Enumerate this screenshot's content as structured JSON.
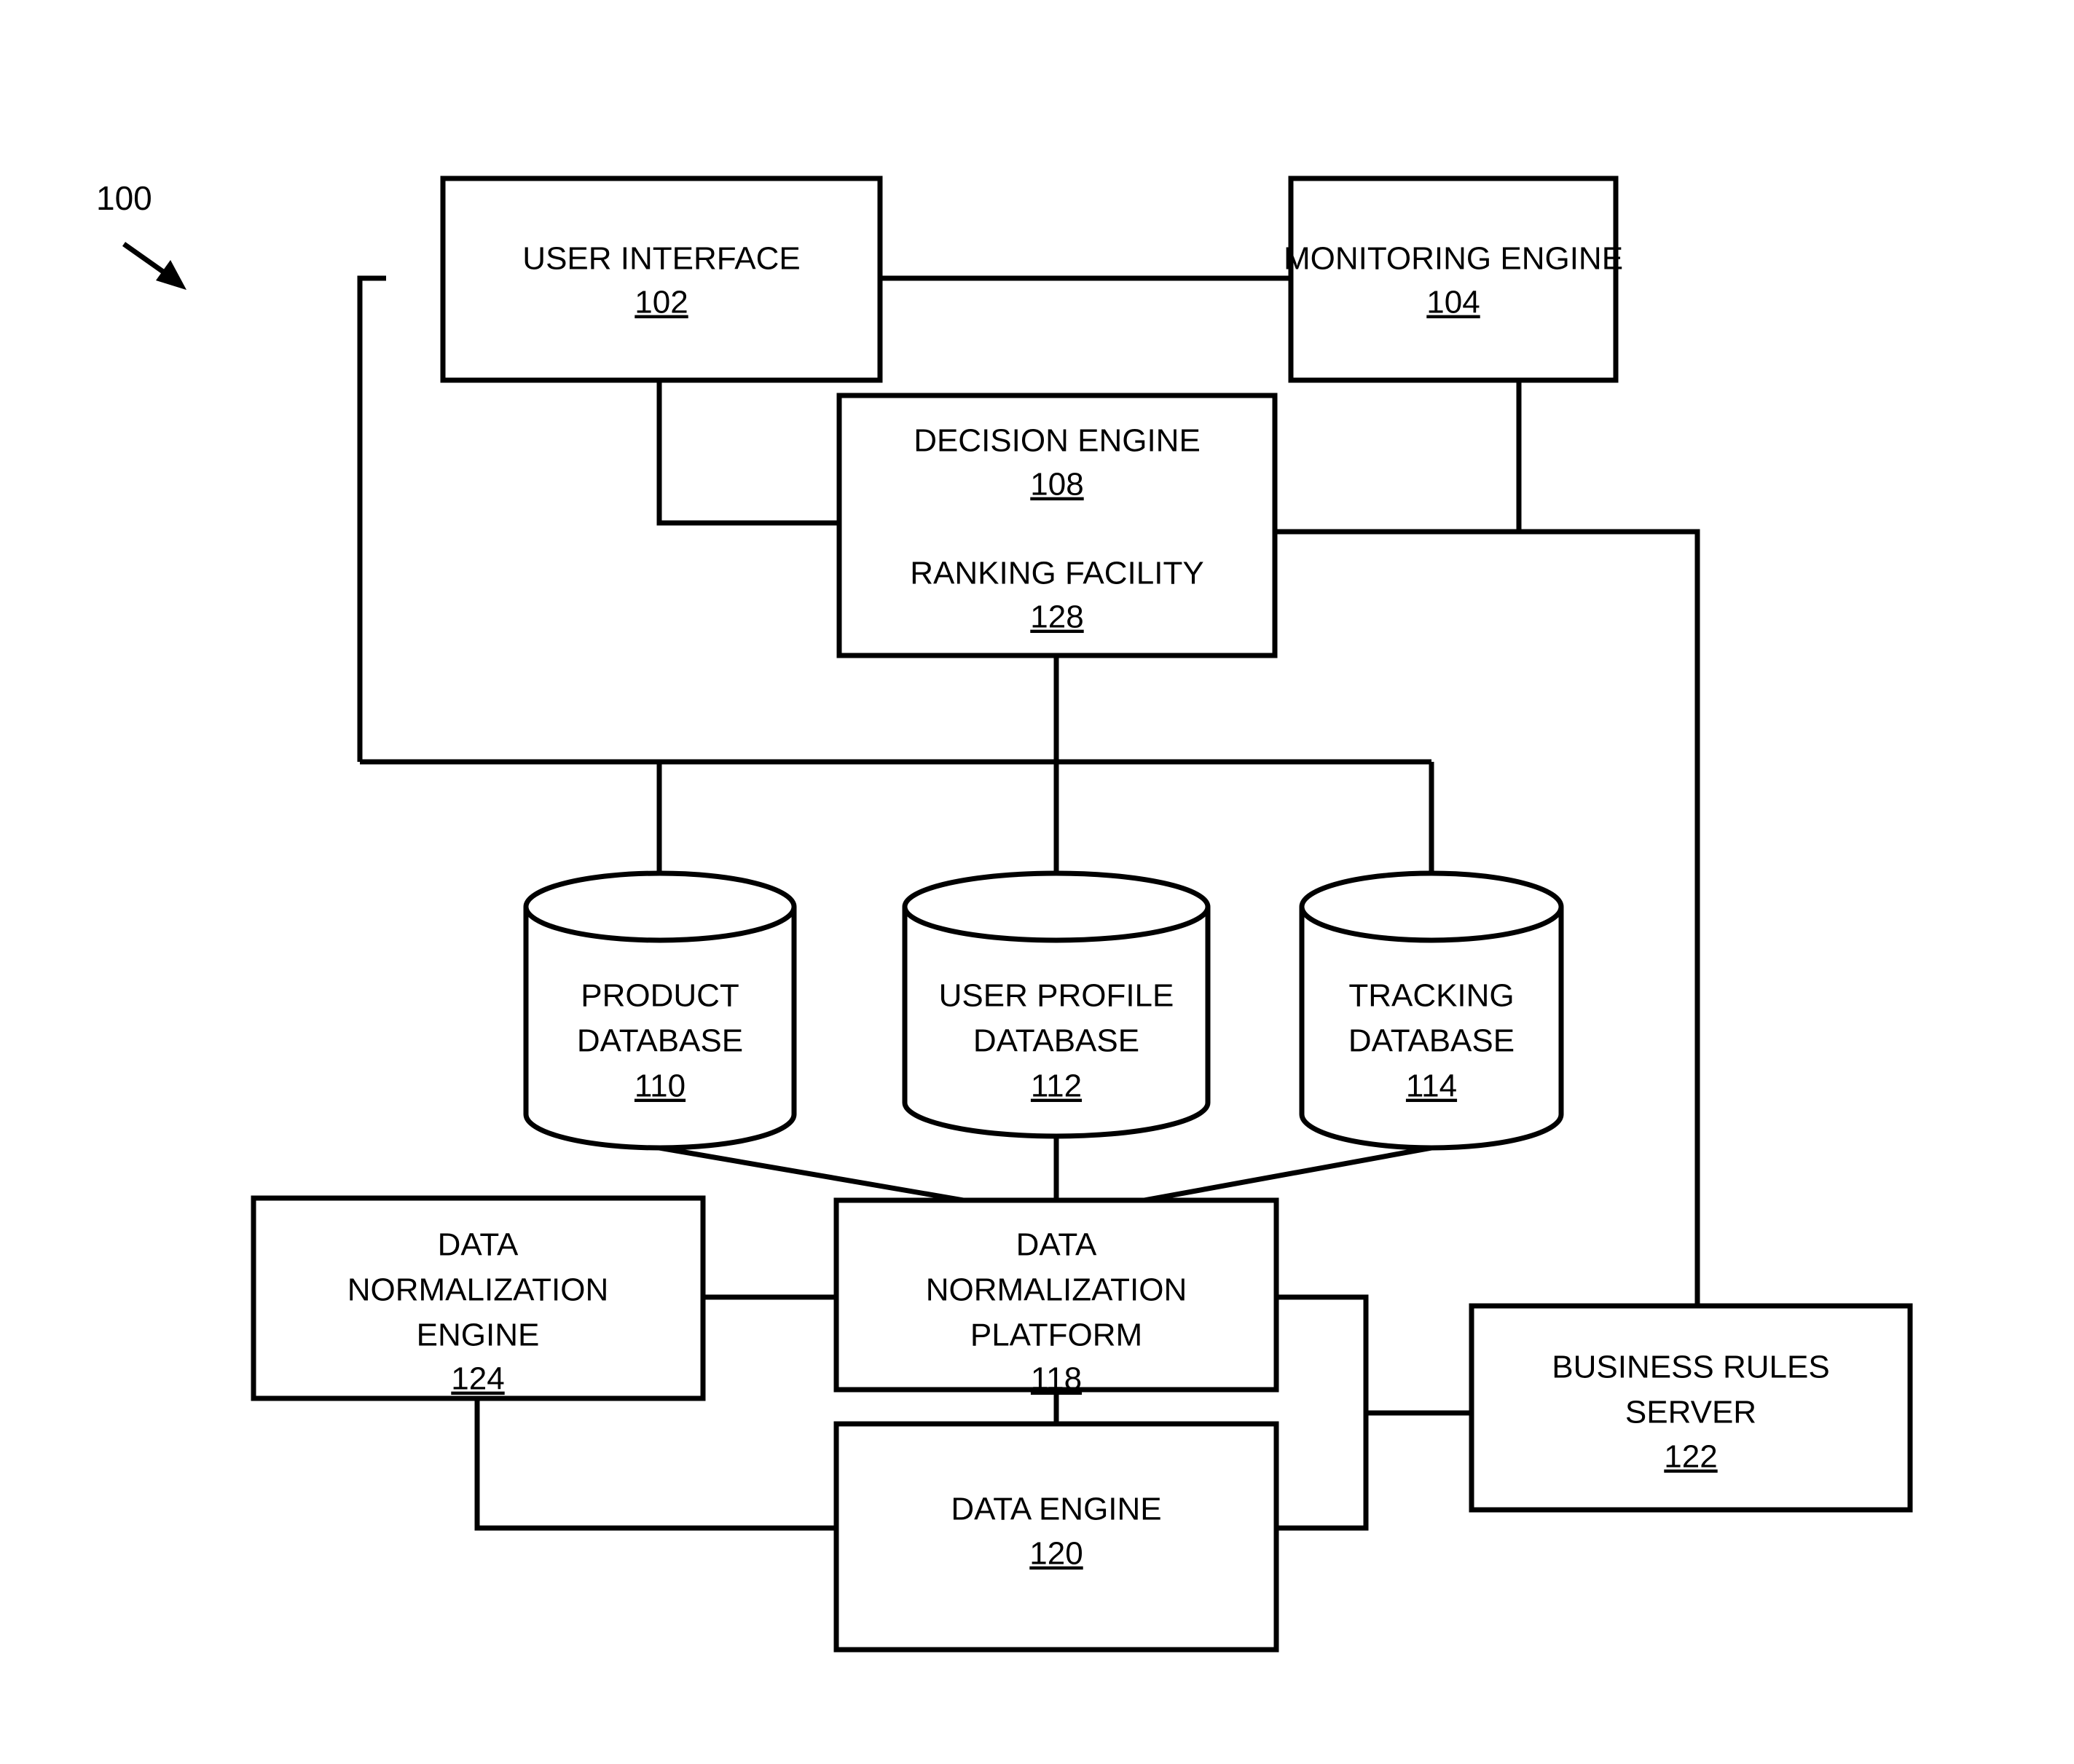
{
  "figure": {
    "label": "100",
    "type": "patent-system-block-diagram"
  },
  "nodes": {
    "user_interface": {
      "title": "USER INTERFACE",
      "ref": "102"
    },
    "monitoring_engine": {
      "title": "MONITORING ENGINE",
      "ref": "104"
    },
    "decision_engine": {
      "title": "DECISION ENGINE",
      "ref": "108"
    },
    "ranking_facility": {
      "title": "RANKING FACILITY",
      "ref": "128"
    },
    "product_database": {
      "line1": "PRODUCT",
      "line2": "DATABASE",
      "ref": "110"
    },
    "user_profile_database": {
      "line1": "USER PROFILE",
      "line2": "DATABASE",
      "ref": "112"
    },
    "tracking_database": {
      "line1": "TRACKING",
      "line2": "DATABASE",
      "ref": "114"
    },
    "data_normalization_engine": {
      "line1": "DATA",
      "line2": "NORMALIZATION",
      "line3": "ENGINE",
      "ref": "124"
    },
    "data_normalization_platform": {
      "line1": "DATA",
      "line2": "NORMALIZATION",
      "line3": "PLATFORM",
      "ref": "118"
    },
    "data_engine": {
      "title": "DATA ENGINE",
      "ref": "120"
    },
    "business_rules_server": {
      "line1": "BUSINESS RULES",
      "line2": "SERVER",
      "ref": "122"
    }
  },
  "colors": {
    "stroke": "#000000",
    "fill": "#ffffff"
  }
}
